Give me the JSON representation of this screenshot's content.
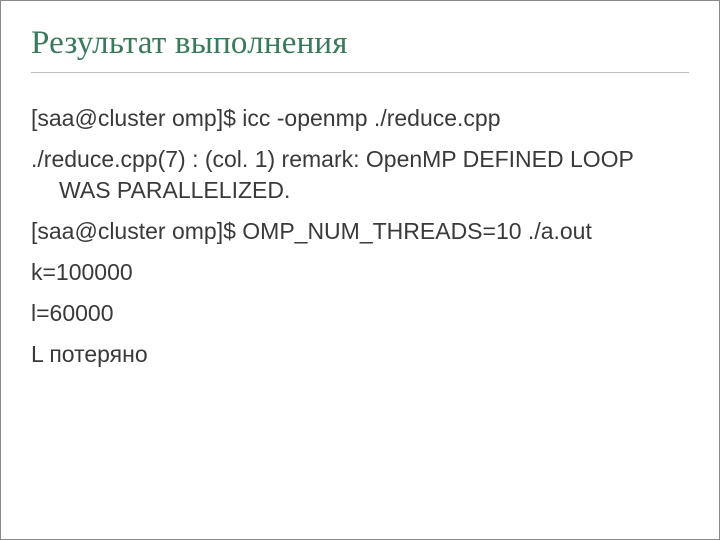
{
  "title": "Результат выполнения",
  "lines": {
    "l1": "[saa@cluster omp]$ icc -openmp ./reduce.cpp",
    "l2": "./reduce.cpp(7) : (col. 1) remark: OpenMP DEFINED LOOP WAS PARALLELIZED.",
    "l3": "[saa@cluster omp]$ OMP_NUM_THREADS=10 ./a.out",
    "l4": "k=100000",
    "l5": "l=60000",
    "l6": "L потеряно"
  }
}
